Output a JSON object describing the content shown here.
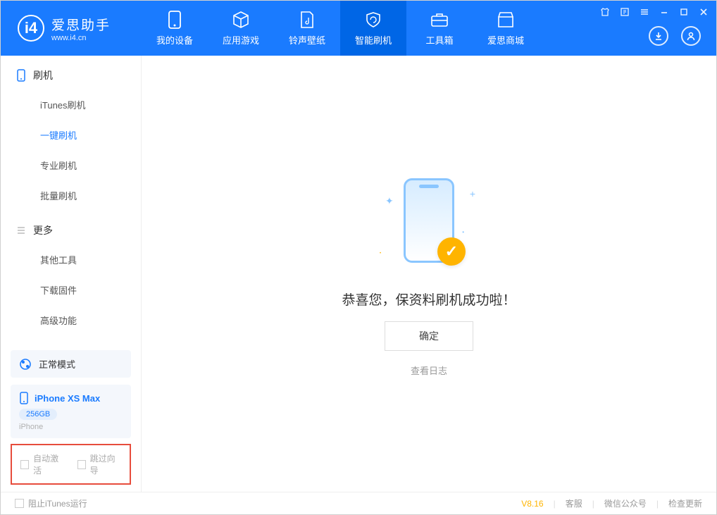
{
  "app": {
    "title": "爱思助手",
    "url": "www.i4.cn"
  },
  "tabs": [
    {
      "label": "我的设备"
    },
    {
      "label": "应用游戏"
    },
    {
      "label": "铃声壁纸"
    },
    {
      "label": "智能刷机"
    },
    {
      "label": "工具箱"
    },
    {
      "label": "爱思商城"
    }
  ],
  "sidebar": {
    "section1": {
      "title": "刷机",
      "items": [
        "iTunes刷机",
        "一键刷机",
        "专业刷机",
        "批量刷机"
      ]
    },
    "section2": {
      "title": "更多",
      "items": [
        "其他工具",
        "下载固件",
        "高级功能"
      ]
    }
  },
  "status": {
    "mode": "正常模式"
  },
  "device": {
    "name": "iPhone XS Max",
    "storage": "256GB",
    "type": "iPhone"
  },
  "options": {
    "auto_activate": "自动激活",
    "skip_guide": "跳过向导"
  },
  "main": {
    "success_text": "恭喜您，保资料刷机成功啦！",
    "ok_button": "确定",
    "view_log": "查看日志"
  },
  "footer": {
    "block_itunes": "阻止iTunes运行",
    "version": "V8.16",
    "service": "客服",
    "wechat": "微信公众号",
    "update": "检查更新"
  }
}
